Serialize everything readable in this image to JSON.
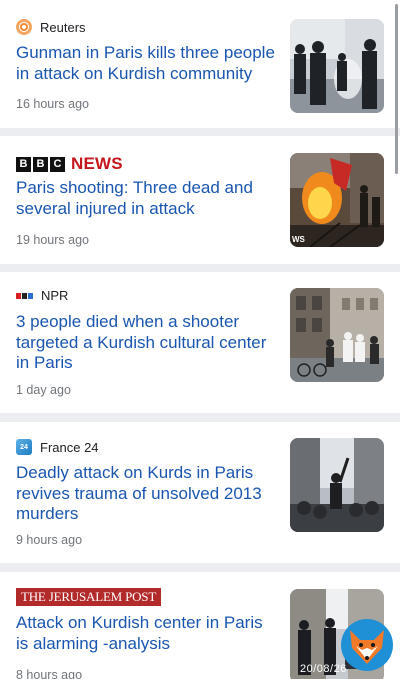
{
  "articles": [
    {
      "source": "Reuters",
      "headline": "Gunman in Paris kills three people in attack on Kurdish community",
      "time": "16 hours ago"
    },
    {
      "source": "BBC NEWS",
      "logo_letters": [
        "B",
        "B",
        "C"
      ],
      "logo_word": "NEWS",
      "headline": "Paris shooting: Three dead and several injured in attack",
      "time": "19 hours ago",
      "thumb_caption": "WS"
    },
    {
      "source": "NPR",
      "headline": "3 people died when a shooter targeted a Kurdish cultural center in Paris",
      "time": "1 day ago"
    },
    {
      "source": "France 24",
      "logo_text": "24",
      "headline": "Deadly attack on Kurds in Paris revives trauma of unsolved 2013 murders",
      "time": "9 hours ago"
    },
    {
      "source": "THE JERUSALEM POST",
      "headline": "Attack on Kurdish center in Paris is alarming -analysis",
      "time": "8 hours ago"
    }
  ],
  "watermark": {
    "date": "20/08/26",
    "icon": "fox-logo-icon"
  },
  "colors": {
    "headline": "#1a56b0",
    "bbc_red": "#c4161c",
    "jpost_red": "#b22a2a",
    "reuters_orange": "#f28c38"
  }
}
